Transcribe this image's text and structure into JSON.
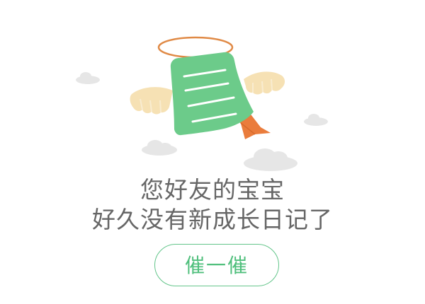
{
  "illustration": {
    "icon": "flying-diary-angel-icon",
    "colors": {
      "page": "#6ccb8a",
      "halo": "#e08a46",
      "wings": "#f6e1b4",
      "ribbon": "#ea7c3c",
      "clouds": "#e6e6e6"
    }
  },
  "message": {
    "line1": "您好友的宝宝",
    "line2": "好久没有新成长日记了"
  },
  "actions": {
    "nudge_label": "催一催",
    "accent": "#4fbf7c"
  }
}
